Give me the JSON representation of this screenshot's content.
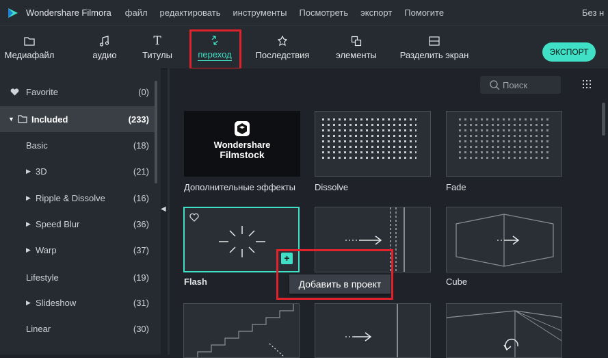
{
  "menubar": {
    "app_title": "Wondershare Filmora",
    "items": [
      "файл",
      "редактировать",
      "инструменты",
      "Посмотреть",
      "экспорт",
      "Помогите"
    ],
    "project_name": "Без н"
  },
  "toolbar": {
    "items": [
      {
        "label": "Медиафайл",
        "icon": "folder-icon"
      },
      {
        "label": "аудио",
        "icon": "music-note-icon"
      },
      {
        "label": "Титулы",
        "icon": "text-icon"
      },
      {
        "label": "переход",
        "icon": "transition-icon",
        "active": true
      },
      {
        "label": "Последствия",
        "icon": "effects-icon"
      },
      {
        "label": "элементы",
        "icon": "elements-icon"
      },
      {
        "label": "Разделить экран",
        "icon": "split-screen-icon"
      }
    ],
    "export_label": "ЭКСПОРТ"
  },
  "sidebar": {
    "items": [
      {
        "name": "Favorite",
        "count": "(0)"
      },
      {
        "name": "Included",
        "count": "(233)"
      },
      {
        "name": "Basic",
        "count": "(18)"
      },
      {
        "name": "3D",
        "count": "(21)"
      },
      {
        "name": "Ripple & Dissolve",
        "count": "(16)"
      },
      {
        "name": "Speed Blur",
        "count": "(36)"
      },
      {
        "name": "Warp",
        "count": "(37)"
      },
      {
        "name": "Lifestyle",
        "count": "(19)"
      },
      {
        "name": "Slideshow",
        "count": "(31)"
      },
      {
        "name": "Linear",
        "count": "(30)"
      }
    ]
  },
  "search": {
    "placeholder": "Поиск"
  },
  "transitions": {
    "filmstock_brand_line1": "Wondershare",
    "filmstock_brand_line2": "Filmstock",
    "labels": [
      "Дополнительные эффекты",
      "Dissolve",
      "Fade",
      "Flash",
      "",
      "Cube"
    ]
  },
  "tooltip": {
    "text": "Добавить в проект"
  },
  "colors": {
    "accent": "#3fe0c5",
    "highlight_box": "#e0222a",
    "background": "#1f2228",
    "panel": "#262a31"
  }
}
